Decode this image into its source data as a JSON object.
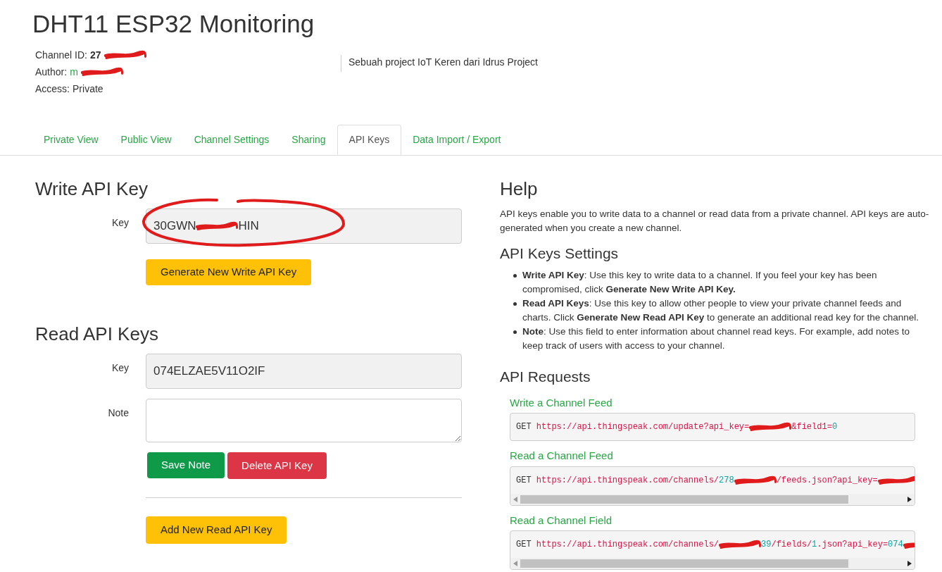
{
  "title": "DHT11 ESP32 Monitoring",
  "meta": [
    {
      "label": "Channel ID:",
      "kind": "bold",
      "parts": [
        {
          "kind": "text",
          "text": "27"
        },
        {
          "kind": "redaction"
        }
      ]
    },
    {
      "label": "Author:",
      "kind": "link",
      "parts": [
        {
          "kind": "text",
          "text": "m"
        },
        {
          "kind": "redaction"
        }
      ]
    },
    {
      "label": "Access:",
      "kind": "plain",
      "parts": [
        {
          "kind": "text",
          "text": "Private"
        }
      ]
    }
  ],
  "description": "Sebuah project IoT Keren dari Idrus Project",
  "tabs": [
    {
      "label": "Private View",
      "selected": false
    },
    {
      "label": "Public View",
      "selected": false
    },
    {
      "label": "Channel Settings",
      "selected": false
    },
    {
      "label": "Sharing",
      "selected": false
    },
    {
      "label": "API Keys",
      "selected": true
    },
    {
      "label": "Data Import / Export",
      "selected": false
    }
  ],
  "write_key": {
    "heading": "Write API Key",
    "label": "Key",
    "value_start": "30GWN",
    "value_end": "HIN",
    "circled": true,
    "button": "Generate New Write API Key"
  },
  "read_keys": {
    "heading": "Read API Keys",
    "key_label": "Key",
    "key": "074ELZAE5V11O2IF",
    "note_label": "Note",
    "save": "Save Note",
    "delete": "Delete API Key",
    "add": "Add New Read API Key"
  },
  "help": {
    "heading": "Help",
    "text": "API keys enable you to write data to a channel or read data from a private channel. API keys are auto-generated when you create a new channel.",
    "settings_heading": "API Keys Settings",
    "bullets": [
      "**Write API Key**: Use this key to write data to a channel. If you feel your key has been compromised, click **Generate New Write API Key.**",
      "**Read API Keys**: Use this key to allow other people to view your private channel feeds and charts. Click **Generate New Read API Key** to generate an additional read key for the channel.",
      "**Note**: Use this field to enter information about channel read keys. For example, add notes to keep track of users with access to your channel."
    ],
    "requests_heading": "API Requests",
    "requests": [
      {
        "title": "Write a Channel Feed",
        "scroll": false,
        "parts": [
          {
            "kind": "verb",
            "text": "GET "
          },
          {
            "kind": "url",
            "text": "https://api.thingspeak.com/update?api_key="
          },
          {
            "kind": "redaction"
          },
          {
            "kind": "url",
            "text": "&field1="
          },
          {
            "kind": "num",
            "text": "0"
          }
        ]
      },
      {
        "title": "Read a Channel Feed",
        "scroll": true,
        "parts": [
          {
            "kind": "verb",
            "text": "GET "
          },
          {
            "kind": "url",
            "text": "https://api.thingspeak.com/channels/"
          },
          {
            "kind": "num",
            "text": "278"
          },
          {
            "kind": "redaction"
          },
          {
            "kind": "url",
            "text": "/feeds.json?api_key="
          },
          {
            "kind": "redaction"
          }
        ]
      },
      {
        "title": "Read a Channel Field",
        "scroll": true,
        "parts": [
          {
            "kind": "verb",
            "text": "GET "
          },
          {
            "kind": "url",
            "text": "https://api.thingspeak.com/channels/"
          },
          {
            "kind": "redaction"
          },
          {
            "kind": "num",
            "text": "39"
          },
          {
            "kind": "url",
            "text": "/fields/"
          },
          {
            "kind": "num",
            "text": "1"
          },
          {
            "kind": "url",
            "text": ".json?api_key="
          },
          {
            "kind": "num",
            "text": "074"
          },
          {
            "kind": "redaction"
          }
        ]
      }
    ]
  }
}
